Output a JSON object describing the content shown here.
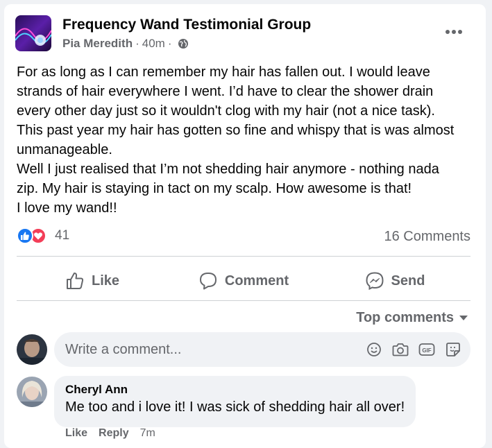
{
  "post": {
    "group_name": "Frequency Wand Testimonial Group",
    "author": "Pia Meredith",
    "time": "40m",
    "lines": [
      "For as long as I can remember my hair has fallen out. I would leave",
      "strands of hair everywhere I went. I’d have to clear the shower drain",
      "every other day just so it wouldn't clog with my hair (not a nice task).",
      "This past year my hair has gotten so fine and whispy that is was almost",
      "unmanageable.",
      "Well I just realised that I’m not shedding hair anymore - nothing nada",
      "zip. My hair is staying in tact on my scalp. How awesome is that!",
      "I love my wand!!"
    ],
    "reaction_count": "41",
    "comments_count": "16 Comments"
  },
  "actions": {
    "like": "Like",
    "comment": "Comment",
    "send": "Send"
  },
  "sort": {
    "label": "Top comments"
  },
  "composer": {
    "placeholder": "Write a comment..."
  },
  "comments": [
    {
      "name": "Cheryl Ann",
      "text": "Me too and i love it! I was sick of shedding hair all over!",
      "like": "Like",
      "reply": "Reply",
      "time": "7m"
    }
  ],
  "icons": {
    "more": "more-options-icon",
    "globe": "globe-icon",
    "like": "thumbs-up-icon",
    "comment": "speech-bubble-icon",
    "send": "messenger-icon",
    "emoji": "emoji-icon",
    "camera": "camera-icon",
    "gif": "gif-icon",
    "sticker": "sticker-icon"
  },
  "colors": {
    "like_blue": "#1877f2",
    "love_red": "#f33e58",
    "secondary_text": "#65676b"
  }
}
